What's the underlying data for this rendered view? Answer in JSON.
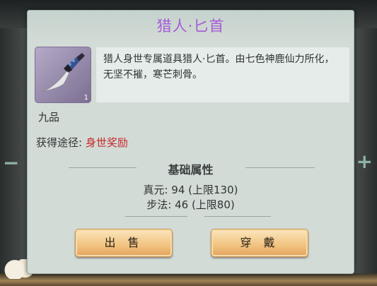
{
  "popup": {
    "title": "猎人·匕首",
    "item_count": "1",
    "description": "猎人身世专属道具猎人·匕首。由七色神鹿仙力所化，无坚不摧，寒芒刺骨。",
    "grade": "九品",
    "source_label": "获得途径:",
    "source_value": "身世奖励",
    "section_title": "基础属性",
    "stats": [
      "真元: 94 (上限130)",
      "步法: 46 (上限80)"
    ],
    "sell_button": "出 售",
    "equip_button": "穿 戴"
  },
  "colors": {
    "title": "#a65bd6",
    "source_value": "#c5282b",
    "button_gold": "#f1c37f",
    "panel": "#d3dbd6"
  },
  "icons": [
    "dagger-icon",
    "plus-icon",
    "minus-icon",
    "cloud-ornament"
  ]
}
